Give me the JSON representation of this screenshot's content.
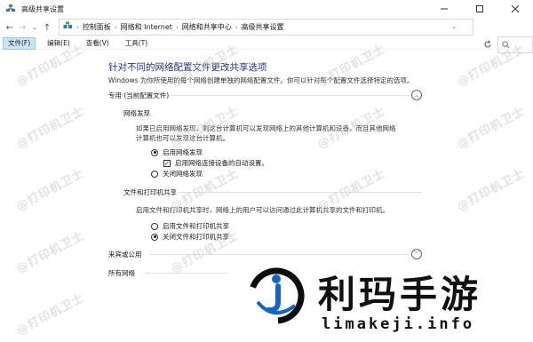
{
  "window": {
    "title": "高级共享设置"
  },
  "address": {
    "breadcrumbs": [
      "控制面板",
      "网络和 Internet",
      "网络和共享中心",
      "高级共享设置"
    ]
  },
  "menu": {
    "items": [
      "文件(F)",
      "编辑(E)",
      "查看(V)",
      "工具(T)"
    ]
  },
  "main": {
    "heading": "针对不同的网络配置文件更改共享选项",
    "description": "Windows 为你所使用的每个网络创建单独的网络配置文件。你可以针对每个配置文件选择特定的选项。",
    "profile_private": "专用 (当前配置文件)",
    "discovery": {
      "title": "网络发现",
      "text": "如果已启用网络发现，则这台计算机可以发现网络上的其他计算机和设备，而且其他网络计算机也可以发现这台计算机。",
      "opt_on": "启用网络发现",
      "opt_auto": "启用网络连接设备的自动设置。",
      "opt_off": "关闭网络发现"
    },
    "sharing": {
      "title": "文件和打印机共享",
      "text": "启用文件和打印机共享时，网络上的用户可以访问通过此计算机共享的文件和打印机。",
      "opt_on": "启用文件和打印机共享",
      "opt_off": "关闭文件和打印机共享"
    },
    "profile_guest": "来宾或公用",
    "profile_all": "所有网络"
  },
  "watermark": "@打印机卫士",
  "brand": {
    "name": "利玛手游",
    "url": "limakeji.info"
  },
  "colors": {
    "heading": "#1e3287",
    "menu_active": "#cce4f7",
    "logo_blue": "#1565c0"
  },
  "state": {
    "discovery_selected": "on",
    "auto_setup_checked": true,
    "sharing_selected": "off"
  }
}
